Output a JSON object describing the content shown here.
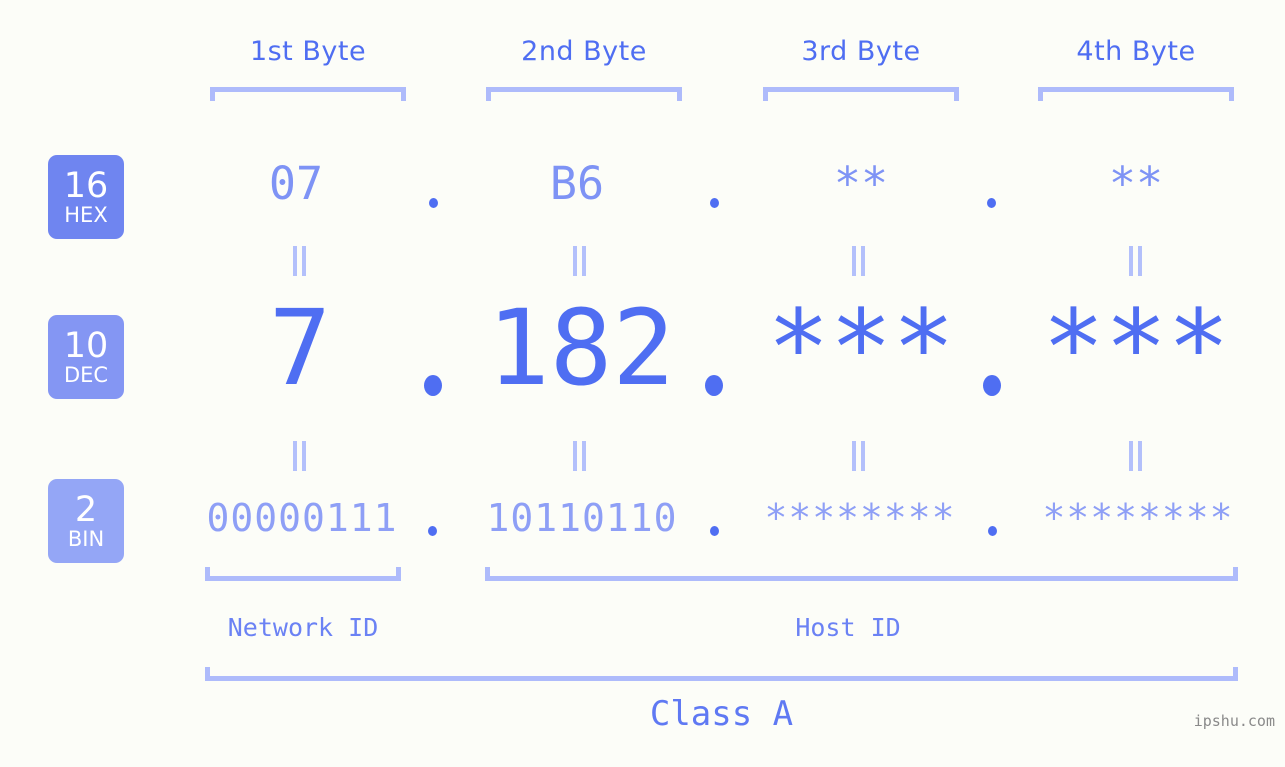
{
  "page": {
    "background_color": "#fcfdf8",
    "accent_color": "#4f6ef2",
    "bracket_color": "#aebbfb",
    "watermark": "ipshu.com"
  },
  "byte_headers": [
    {
      "label": "1st Byte"
    },
    {
      "label": "2nd Byte"
    },
    {
      "label": "3rd Byte"
    },
    {
      "label": "4th Byte"
    }
  ],
  "bases": [
    {
      "number": "16",
      "name": "HEX",
      "color": "#6f85f0"
    },
    {
      "number": "10",
      "name": "DEC",
      "color": "#8496f3"
    },
    {
      "number": "2",
      "name": "BIN",
      "color": "#94a6f6"
    }
  ],
  "rows": {
    "hex": {
      "values": [
        "07",
        "B6",
        "**",
        "**"
      ],
      "separator": "."
    },
    "dec": {
      "values": [
        "7",
        "182",
        "***",
        "***"
      ],
      "separator": "."
    },
    "bin": {
      "values": [
        "00000111",
        "10110110",
        "********",
        "********"
      ],
      "separator": "."
    }
  },
  "equals_symbol": "||",
  "segments": {
    "network_id": "Network ID",
    "host_id": "Host ID"
  },
  "class": {
    "label": "Class A"
  }
}
